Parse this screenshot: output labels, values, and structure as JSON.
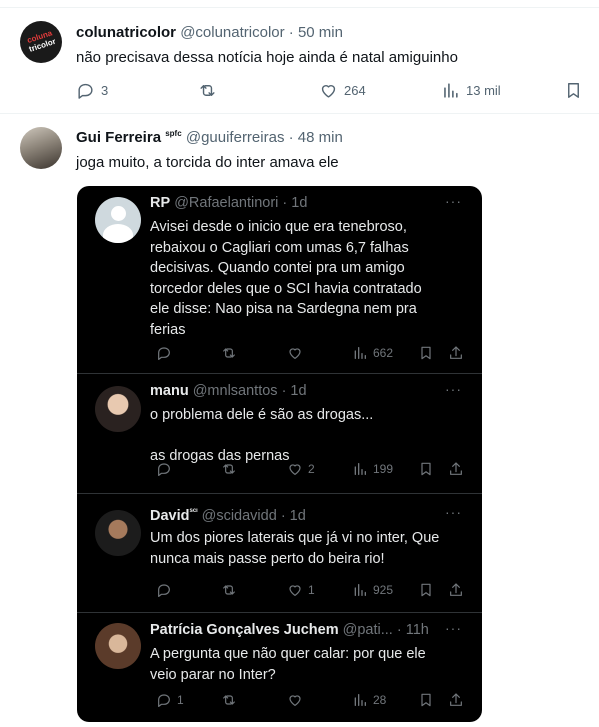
{
  "tweet1": {
    "avatar_text_top": "coluna",
    "avatar_text_bottom": "tricolor",
    "name": "colunatricolor",
    "handle": "@colunatricolor",
    "time": "· 50 min",
    "text": "não precisava dessa notícia hoje ainda é natal amiguinho",
    "replies": "3",
    "retweets": "",
    "likes": "264",
    "views": "13 mil"
  },
  "tweet2": {
    "name": "Gui Ferreira",
    "badge": "spfc",
    "handle": "@guuiferreiras",
    "time": "· 48 min",
    "text": "joga muito, a torcida do inter amava ele"
  },
  "thread": [
    {
      "name": "RP",
      "handle": "@Rafaelantinori",
      "time": "· 1d",
      "lines": [
        "Avisei desde o inicio que era tenebroso,",
        "rebaixou o Cagliari com umas 6,7 falhas",
        "decisivas. Quando contei pra um amigo",
        "torcedor deles que o SCI havia contratado",
        "ele disse: Nao pisa na Sardegna nem pra",
        "ferias"
      ],
      "replies": "",
      "retweets": "",
      "likes": "",
      "views": "662"
    },
    {
      "name": "manu",
      "handle": "@mnlsanttos",
      "time": "· 1d",
      "line1": "o problema dele é são as drogas...",
      "line2": "as drogas das pernas",
      "replies": "",
      "retweets": "",
      "likes": "2",
      "views": "199"
    },
    {
      "name": "David",
      "badge": "ˢᶜᶦ",
      "handle": "@scidavidd",
      "time": "· 1d",
      "line1": "Um dos piores laterais que já vi no inter, Que",
      "line2": "nunca mais passe perto do beira rio!",
      "replies": "",
      "retweets": "",
      "likes": "1",
      "views": "925"
    },
    {
      "name": "Patrícia Gonçalves Juchem",
      "handle": "@pati...",
      "time": "· 11h",
      "line1": "A pergunta que não quer calar: por que ele",
      "line2": "veio parar no Inter?",
      "replies": "1",
      "retweets": "",
      "likes": "",
      "views": "28"
    }
  ],
  "more_label": "···",
  "colors": {
    "text": "#0f1419",
    "muted": "#536471",
    "dark_bg": "#000000",
    "dark_text": "#e7e9ea",
    "dark_muted": "#71767b"
  }
}
